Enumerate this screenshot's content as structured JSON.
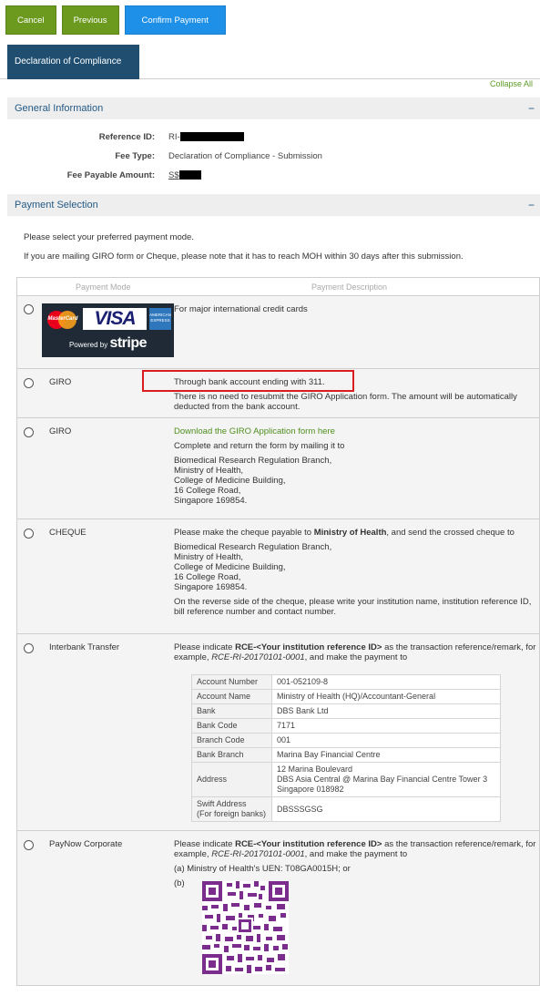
{
  "toolbar": {
    "cancel_label": "Cancel",
    "previous_label": "Previous",
    "confirm_label": "Confirm Payment"
  },
  "tabs": {
    "active_label": "Declaration of Compliance"
  },
  "collapse_all_label": "Collapse All",
  "general_info": {
    "title": "General Information",
    "toggle": "−",
    "reference_id_label": "Reference ID:",
    "reference_id_prefix": "RI-",
    "fee_type_label": "Fee Type:",
    "fee_type_value": "Declaration of Compliance - Submission",
    "fee_amount_label": "Fee Payable Amount:",
    "fee_amount_prefix": "S$"
  },
  "payment_selection": {
    "title": "Payment Selection",
    "toggle": "−",
    "instruction": "Please select your preferred payment mode.",
    "mail_note": "If you are mailing GIRO form or Cheque, please note that it has to reach MOH within 30 days after this submission."
  },
  "table_headers": {
    "mode": "Payment Mode",
    "description": "Payment Description"
  },
  "card_row": {
    "description": "For major international credit cards",
    "mastercard_text": "MasterCard",
    "visa_text": "VISA",
    "amex_text": "AMERICAN EXPRESS",
    "powered_by": "Powered by",
    "stripe_text": "stripe"
  },
  "giro_bank_row": {
    "mode": "GIRO",
    "line1": "Through bank account ending with 311.",
    "line2": "There is no need to resubmit the GIRO Application form. The amount will be automatically deducted from the bank account."
  },
  "giro_form_row": {
    "mode": "GIRO",
    "download_link": "Download the GIRO Application form here",
    "line1": "Complete and return the form by mailing it to",
    "addr1": "Biomedical Research Regulation Branch,",
    "addr2": "Ministry of Health,",
    "addr3": "College of Medicine Building,",
    "addr4": "16 College Road,",
    "addr5": "Singapore 169854."
  },
  "cheque_row": {
    "mode": "CHEQUE",
    "line1_pre": "Please make the cheque payable to ",
    "line1_bold": "Ministry of Health",
    "line1_post": ", and send the crossed cheque to",
    "addr1": "Biomedical Research Regulation Branch,",
    "addr2": "Ministry of Health,",
    "addr3": "College of Medicine Building,",
    "addr4": "16 College Road,",
    "addr5": "Singapore 169854.",
    "line2": "On the reverse side of the cheque, please write your institution name, institution reference ID, bill reference number and contact number."
  },
  "interbank_row": {
    "mode": "Interbank Transfer",
    "line_pre": "Please indicate ",
    "line_bold": "RCE-<Your institution reference ID>",
    "line_mid": " as the transaction reference/remark, for example, ",
    "line_italic": "RCE-RI-20170101-0001",
    "line_post": ", and make the payment to",
    "bank": [
      {
        "k": "Account Number",
        "v": "001-052109-8"
      },
      {
        "k": "Account Name",
        "v": "Ministry of Health (HQ)/Accountant-General"
      },
      {
        "k": "Bank",
        "v": "DBS Bank Ltd"
      },
      {
        "k": "Bank Code",
        "v": "7171"
      },
      {
        "k": "Branch Code",
        "v": "001"
      },
      {
        "k": "Bank Branch",
        "v": "Marina Bay Financial Centre"
      },
      {
        "k": "Address",
        "v1": "12 Marina Boulevard",
        "v2": "DBS Asia Central @ Marina Bay Financial Centre Tower 3",
        "v3": "Singapore 018982"
      },
      {
        "k1": "Swift Address",
        "k2": "(For foreign banks)",
        "v": "DBSSSGSG"
      }
    ]
  },
  "paynow_row": {
    "mode": "PayNow Corporate",
    "line_pre": "Please indicate ",
    "line_bold": "RCE-<Your institution reference ID>",
    "line_mid": " as the transaction reference/remark, for example, ",
    "line_italic": "RCE-RI-20170101-0001",
    "line_post": ", and make the payment to",
    "option_a": "(a) Ministry of Health's UEN: T08GA0015H; or",
    "option_b": "(b)"
  },
  "colors": {
    "green_button": "#6c9a1f",
    "blue_button": "#1e90e8",
    "tab_active": "#1f4e70",
    "section_title": "#245a86",
    "highlight": "#d81e1e",
    "qr_code": "#7a2d8c"
  }
}
